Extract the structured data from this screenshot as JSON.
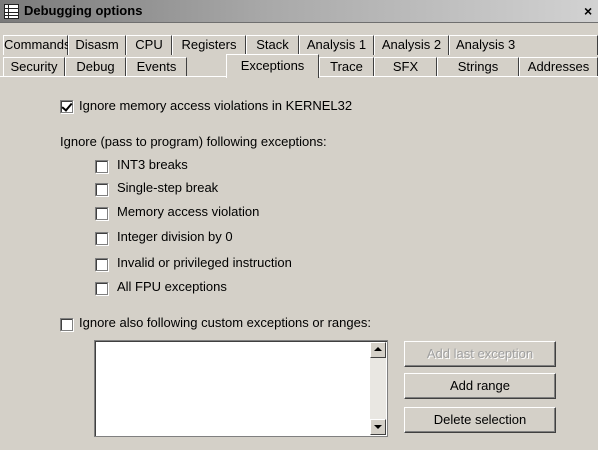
{
  "window": {
    "title": "Debugging options"
  },
  "tabs_row1": [
    "Commands",
    "Disasm",
    "CPU",
    "Registers",
    "Stack",
    "Analysis 1",
    "Analysis 2",
    "Analysis 3"
  ],
  "tabs_row2": [
    "Security",
    "Debug",
    "Events",
    "Exceptions",
    "Trace",
    "SFX",
    "Strings",
    "Addresses"
  ],
  "active_tab": "Exceptions",
  "options": {
    "ignore_kernel32": {
      "label": "Ignore memory access violations in KERNEL32",
      "checked": true
    },
    "ignore_heading": "Ignore (pass to program) following exceptions:",
    "exceptions": [
      {
        "label": "INT3 breaks",
        "checked": false
      },
      {
        "label": "Single-step break",
        "checked": false
      },
      {
        "label": "Memory access violation",
        "checked": false
      },
      {
        "label": "Integer division by 0",
        "checked": false
      },
      {
        "label": "Invalid or privileged instruction",
        "checked": false
      },
      {
        "label": "All FPU exceptions",
        "checked": false
      }
    ],
    "custom": {
      "label": "Ignore also following custom exceptions or ranges:",
      "checked": false
    }
  },
  "custom_list": {
    "items": []
  },
  "buttons": {
    "add_last_exception": "Add last exception",
    "add_range": "Add range",
    "delete_selection": "Delete selection"
  }
}
